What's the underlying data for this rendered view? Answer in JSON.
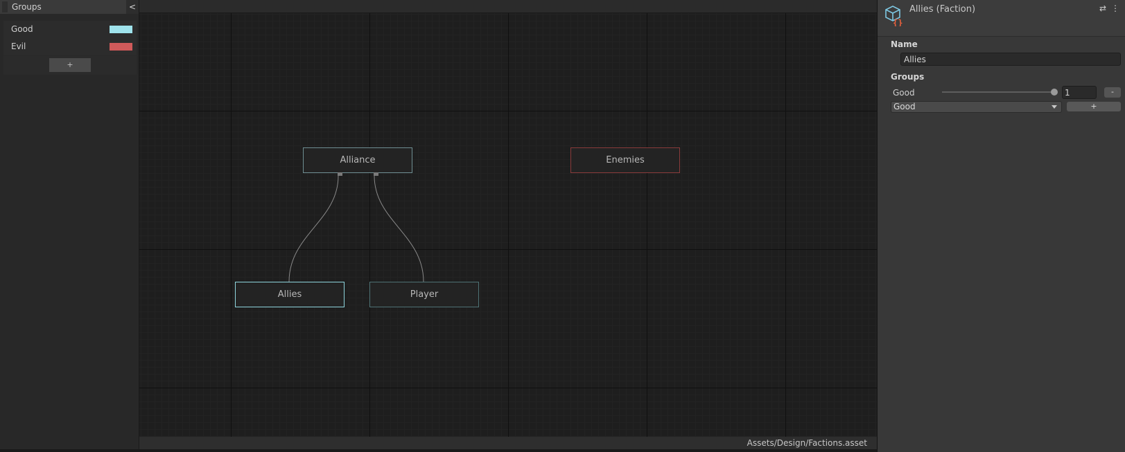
{
  "groups_panel": {
    "title": "Groups",
    "collapse_label": "<",
    "add_label": "+",
    "groups": [
      {
        "label": "Good",
        "color": "#9fe3ec"
      },
      {
        "label": "Evil",
        "color": "#d05a5a"
      }
    ]
  },
  "graph": {
    "nodes": {
      "alliance": {
        "label": "Alliance",
        "border_color": "#6f8f93"
      },
      "enemies": {
        "label": "Enemies",
        "border_color": "#8a3b3b"
      },
      "allies": {
        "label": "Allies",
        "border_color": "#8fd6de"
      },
      "player": {
        "label": "Player",
        "border_color": "#4e7275"
      }
    },
    "edges": [
      {
        "from": "alliance",
        "to": "allies"
      },
      {
        "from": "alliance",
        "to": "player"
      }
    ],
    "status_path": "Assets/Design/Factions.asset"
  },
  "inspector": {
    "title": "Allies (Faction)",
    "name_section": "Name",
    "name_value": "Allies",
    "groups_section": "Groups",
    "group_entry_label": "Good",
    "weight_value": "1",
    "weight_fraction": 1.0,
    "remove_label": "-",
    "selected_group": "Good",
    "add_label": "+"
  }
}
